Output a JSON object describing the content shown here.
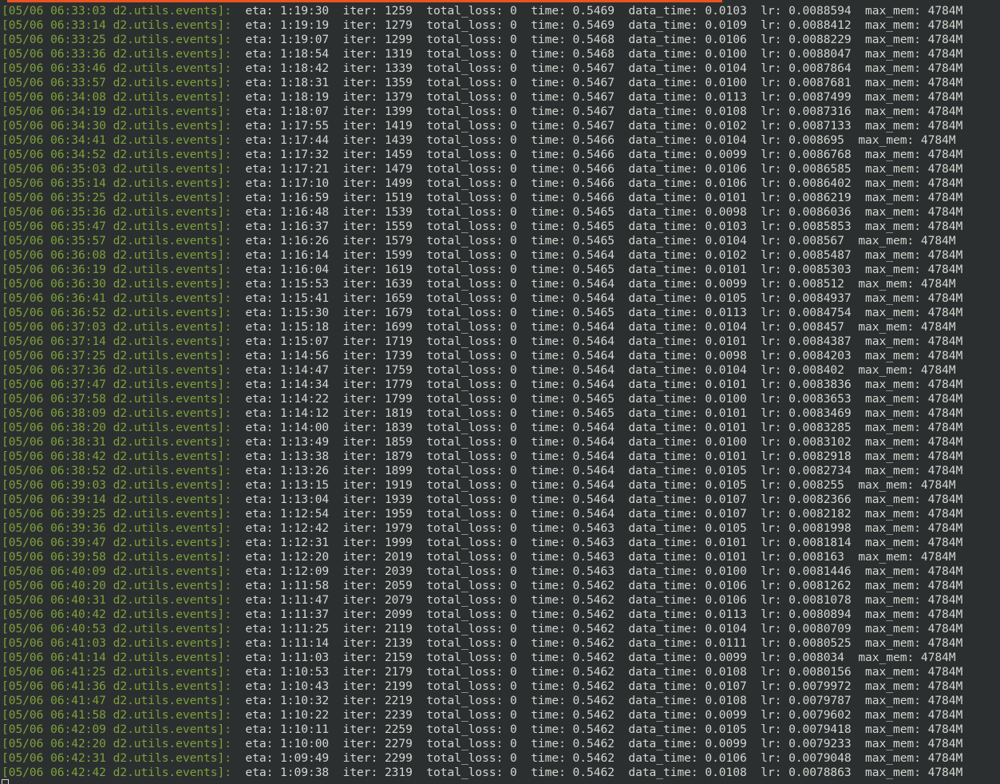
{
  "colors": {
    "background": "#2c2f30",
    "text": "#d3d7cf",
    "prefix": "#7ea13a",
    "progress_bar": "#e95420"
  },
  "log_lines": [
    {
      "prefix": "[05/06 06:33:03 d2.utils.events]: ",
      "text": " eta: 1:19:30  iter: 1259  total_loss: 0  time: 0.5469  data_time: 0.0103  lr: 0.0088594  max_mem: 4784M"
    },
    {
      "prefix": "[05/06 06:33:14 d2.utils.events]: ",
      "text": " eta: 1:19:19  iter: 1279  total_loss: 0  time: 0.5469  data_time: 0.0109  lr: 0.0088412  max_mem: 4784M"
    },
    {
      "prefix": "[05/06 06:33:25 d2.utils.events]: ",
      "text": " eta: 1:19:07  iter: 1299  total_loss: 0  time: 0.5468  data_time: 0.0106  lr: 0.0088229  max_mem: 4784M"
    },
    {
      "prefix": "[05/06 06:33:36 d2.utils.events]: ",
      "text": " eta: 1:18:54  iter: 1319  total_loss: 0  time: 0.5468  data_time: 0.0100  lr: 0.0088047  max_mem: 4784M"
    },
    {
      "prefix": "[05/06 06:33:46 d2.utils.events]: ",
      "text": " eta: 1:18:42  iter: 1339  total_loss: 0  time: 0.5467  data_time: 0.0104  lr: 0.0087864  max_mem: 4784M"
    },
    {
      "prefix": "[05/06 06:33:57 d2.utils.events]: ",
      "text": " eta: 1:18:31  iter: 1359  total_loss: 0  time: 0.5467  data_time: 0.0100  lr: 0.0087681  max_mem: 4784M"
    },
    {
      "prefix": "[05/06 06:34:08 d2.utils.events]: ",
      "text": " eta: 1:18:19  iter: 1379  total_loss: 0  time: 0.5467  data_time: 0.0113  lr: 0.0087499  max_mem: 4784M"
    },
    {
      "prefix": "[05/06 06:34:19 d2.utils.events]: ",
      "text": " eta: 1:18:07  iter: 1399  total_loss: 0  time: 0.5467  data_time: 0.0108  lr: 0.0087316  max_mem: 4784M"
    },
    {
      "prefix": "[05/06 06:34:30 d2.utils.events]: ",
      "text": " eta: 1:17:55  iter: 1419  total_loss: 0  time: 0.5467  data_time: 0.0102  lr: 0.0087133  max_mem: 4784M"
    },
    {
      "prefix": "[05/06 06:34:41 d2.utils.events]: ",
      "text": " eta: 1:17:44  iter: 1439  total_loss: 0  time: 0.5466  data_time: 0.0104  lr: 0.008695  max_mem: 4784M"
    },
    {
      "prefix": "[05/06 06:34:52 d2.utils.events]: ",
      "text": " eta: 1:17:32  iter: 1459  total_loss: 0  time: 0.5466  data_time: 0.0099  lr: 0.0086768  max_mem: 4784M"
    },
    {
      "prefix": "[05/06 06:35:03 d2.utils.events]: ",
      "text": " eta: 1:17:21  iter: 1479  total_loss: 0  time: 0.5466  data_time: 0.0106  lr: 0.0086585  max_mem: 4784M"
    },
    {
      "prefix": "[05/06 06:35:14 d2.utils.events]: ",
      "text": " eta: 1:17:10  iter: 1499  total_loss: 0  time: 0.5466  data_time: 0.0106  lr: 0.0086402  max_mem: 4784M"
    },
    {
      "prefix": "[05/06 06:35:25 d2.utils.events]: ",
      "text": " eta: 1:16:59  iter: 1519  total_loss: 0  time: 0.5466  data_time: 0.0101  lr: 0.0086219  max_mem: 4784M"
    },
    {
      "prefix": "[05/06 06:35:36 d2.utils.events]: ",
      "text": " eta: 1:16:48  iter: 1539  total_loss: 0  time: 0.5465  data_time: 0.0098  lr: 0.0086036  max_mem: 4784M"
    },
    {
      "prefix": "[05/06 06:35:47 d2.utils.events]: ",
      "text": " eta: 1:16:37  iter: 1559  total_loss: 0  time: 0.5465  data_time: 0.0103  lr: 0.0085853  max_mem: 4784M"
    },
    {
      "prefix": "[05/06 06:35:57 d2.utils.events]: ",
      "text": " eta: 1:16:26  iter: 1579  total_loss: 0  time: 0.5465  data_time: 0.0104  lr: 0.008567  max_mem: 4784M"
    },
    {
      "prefix": "[05/06 06:36:08 d2.utils.events]: ",
      "text": " eta: 1:16:14  iter: 1599  total_loss: 0  time: 0.5464  data_time: 0.0102  lr: 0.0085487  max_mem: 4784M"
    },
    {
      "prefix": "[05/06 06:36:19 d2.utils.events]: ",
      "text": " eta: 1:16:04  iter: 1619  total_loss: 0  time: 0.5465  data_time: 0.0101  lr: 0.0085303  max_mem: 4784M"
    },
    {
      "prefix": "[05/06 06:36:30 d2.utils.events]: ",
      "text": " eta: 1:15:53  iter: 1639  total_loss: 0  time: 0.5464  data_time: 0.0099  lr: 0.008512  max_mem: 4784M"
    },
    {
      "prefix": "[05/06 06:36:41 d2.utils.events]: ",
      "text": " eta: 1:15:41  iter: 1659  total_loss: 0  time: 0.5464  data_time: 0.0105  lr: 0.0084937  max_mem: 4784M"
    },
    {
      "prefix": "[05/06 06:36:52 d2.utils.events]: ",
      "text": " eta: 1:15:30  iter: 1679  total_loss: 0  time: 0.5465  data_time: 0.0113  lr: 0.0084754  max_mem: 4784M"
    },
    {
      "prefix": "[05/06 06:37:03 d2.utils.events]: ",
      "text": " eta: 1:15:18  iter: 1699  total_loss: 0  time: 0.5464  data_time: 0.0104  lr: 0.008457  max_mem: 4784M"
    },
    {
      "prefix": "[05/06 06:37:14 d2.utils.events]: ",
      "text": " eta: 1:15:07  iter: 1719  total_loss: 0  time: 0.5464  data_time: 0.0101  lr: 0.0084387  max_mem: 4784M"
    },
    {
      "prefix": "[05/06 06:37:25 d2.utils.events]: ",
      "text": " eta: 1:14:56  iter: 1739  total_loss: 0  time: 0.5464  data_time: 0.0098  lr: 0.0084203  max_mem: 4784M"
    },
    {
      "prefix": "[05/06 06:37:36 d2.utils.events]: ",
      "text": " eta: 1:14:47  iter: 1759  total_loss: 0  time: 0.5464  data_time: 0.0104  lr: 0.008402  max_mem: 4784M"
    },
    {
      "prefix": "[05/06 06:37:47 d2.utils.events]: ",
      "text": " eta: 1:14:34  iter: 1779  total_loss: 0  time: 0.5464  data_time: 0.0101  lr: 0.0083836  max_mem: 4784M"
    },
    {
      "prefix": "[05/06 06:37:58 d2.utils.events]: ",
      "text": " eta: 1:14:22  iter: 1799  total_loss: 0  time: 0.5465  data_time: 0.0100  lr: 0.0083653  max_mem: 4784M"
    },
    {
      "prefix": "[05/06 06:38:09 d2.utils.events]: ",
      "text": " eta: 1:14:12  iter: 1819  total_loss: 0  time: 0.5465  data_time: 0.0101  lr: 0.0083469  max_mem: 4784M"
    },
    {
      "prefix": "[05/06 06:38:20 d2.utils.events]: ",
      "text": " eta: 1:14:00  iter: 1839  total_loss: 0  time: 0.5464  data_time: 0.0101  lr: 0.0083285  max_mem: 4784M"
    },
    {
      "prefix": "[05/06 06:38:31 d2.utils.events]: ",
      "text": " eta: 1:13:49  iter: 1859  total_loss: 0  time: 0.5464  data_time: 0.0100  lr: 0.0083102  max_mem: 4784M"
    },
    {
      "prefix": "[05/06 06:38:42 d2.utils.events]: ",
      "text": " eta: 1:13:38  iter: 1879  total_loss: 0  time: 0.5464  data_time: 0.0101  lr: 0.0082918  max_mem: 4784M"
    },
    {
      "prefix": "[05/06 06:38:52 d2.utils.events]: ",
      "text": " eta: 1:13:26  iter: 1899  total_loss: 0  time: 0.5464  data_time: 0.0105  lr: 0.0082734  max_mem: 4784M"
    },
    {
      "prefix": "[05/06 06:39:03 d2.utils.events]: ",
      "text": " eta: 1:13:15  iter: 1919  total_loss: 0  time: 0.5464  data_time: 0.0105  lr: 0.008255  max_mem: 4784M"
    },
    {
      "prefix": "[05/06 06:39:14 d2.utils.events]: ",
      "text": " eta: 1:13:04  iter: 1939  total_loss: 0  time: 0.5464  data_time: 0.0107  lr: 0.0082366  max_mem: 4784M"
    },
    {
      "prefix": "[05/06 06:39:25 d2.utils.events]: ",
      "text": " eta: 1:12:54  iter: 1959  total_loss: 0  time: 0.5464  data_time: 0.0107  lr: 0.0082182  max_mem: 4784M"
    },
    {
      "prefix": "[05/06 06:39:36 d2.utils.events]: ",
      "text": " eta: 1:12:42  iter: 1979  total_loss: 0  time: 0.5463  data_time: 0.0105  lr: 0.0081998  max_mem: 4784M"
    },
    {
      "prefix": "[05/06 06:39:47 d2.utils.events]: ",
      "text": " eta: 1:12:31  iter: 1999  total_loss: 0  time: 0.5463  data_time: 0.0101  lr: 0.0081814  max_mem: 4784M"
    },
    {
      "prefix": "[05/06 06:39:58 d2.utils.events]: ",
      "text": " eta: 1:12:20  iter: 2019  total_loss: 0  time: 0.5463  data_time: 0.0101  lr: 0.008163  max_mem: 4784M"
    },
    {
      "prefix": "[05/06 06:40:09 d2.utils.events]: ",
      "text": " eta: 1:12:09  iter: 2039  total_loss: 0  time: 0.5463  data_time: 0.0100  lr: 0.0081446  max_mem: 4784M"
    },
    {
      "prefix": "[05/06 06:40:20 d2.utils.events]: ",
      "text": " eta: 1:11:58  iter: 2059  total_loss: 0  time: 0.5462  data_time: 0.0106  lr: 0.0081262  max_mem: 4784M"
    },
    {
      "prefix": "[05/06 06:40:31 d2.utils.events]: ",
      "text": " eta: 1:11:47  iter: 2079  total_loss: 0  time: 0.5462  data_time: 0.0106  lr: 0.0081078  max_mem: 4784M"
    },
    {
      "prefix": "[05/06 06:40:42 d2.utils.events]: ",
      "text": " eta: 1:11:37  iter: 2099  total_loss: 0  time: 0.5462  data_time: 0.0113  lr: 0.0080894  max_mem: 4784M"
    },
    {
      "prefix": "[05/06 06:40:53 d2.utils.events]: ",
      "text": " eta: 1:11:25  iter: 2119  total_loss: 0  time: 0.5462  data_time: 0.0104  lr: 0.0080709  max_mem: 4784M"
    },
    {
      "prefix": "[05/06 06:41:03 d2.utils.events]: ",
      "text": " eta: 1:11:14  iter: 2139  total_loss: 0  time: 0.5462  data_time: 0.0111  lr: 0.0080525  max_mem: 4784M"
    },
    {
      "prefix": "[05/06 06:41:14 d2.utils.events]: ",
      "text": " eta: 1:11:03  iter: 2159  total_loss: 0  time: 0.5462  data_time: 0.0099  lr: 0.008034  max_mem: 4784M"
    },
    {
      "prefix": "[05/06 06:41:25 d2.utils.events]: ",
      "text": " eta: 1:10:53  iter: 2179  total_loss: 0  time: 0.5462  data_time: 0.0108  lr: 0.0080156  max_mem: 4784M"
    },
    {
      "prefix": "[05/06 06:41:36 d2.utils.events]: ",
      "text": " eta: 1:10:43  iter: 2199  total_loss: 0  time: 0.5462  data_time: 0.0107  lr: 0.0079972  max_mem: 4784M"
    },
    {
      "prefix": "[05/06 06:41:47 d2.utils.events]: ",
      "text": " eta: 1:10:32  iter: 2219  total_loss: 0  time: 0.5462  data_time: 0.0108  lr: 0.0079787  max_mem: 4784M"
    },
    {
      "prefix": "[05/06 06:41:58 d2.utils.events]: ",
      "text": " eta: 1:10:22  iter: 2239  total_loss: 0  time: 0.5462  data_time: 0.0099  lr: 0.0079602  max_mem: 4784M"
    },
    {
      "prefix": "[05/06 06:42:09 d2.utils.events]: ",
      "text": " eta: 1:10:11  iter: 2259  total_loss: 0  time: 0.5462  data_time: 0.0105  lr: 0.0079418  max_mem: 4784M"
    },
    {
      "prefix": "[05/06 06:42:20 d2.utils.events]: ",
      "text": " eta: 1:10:00  iter: 2279  total_loss: 0  time: 0.5462  data_time: 0.0099  lr: 0.0079233  max_mem: 4784M"
    },
    {
      "prefix": "[05/06 06:42:31 d2.utils.events]: ",
      "text": " eta: 1:09:49  iter: 2299  total_loss: 0  time: 0.5462  data_time: 0.0106  lr: 0.0079048  max_mem: 4784M"
    },
    {
      "prefix": "[05/06 06:42:42 d2.utils.events]: ",
      "text": " eta: 1:09:38  iter: 2319  total_loss: 0  time: 0.5462  data_time: 0.0108  lr: 0.0078863  max_mem: 4784M"
    }
  ]
}
